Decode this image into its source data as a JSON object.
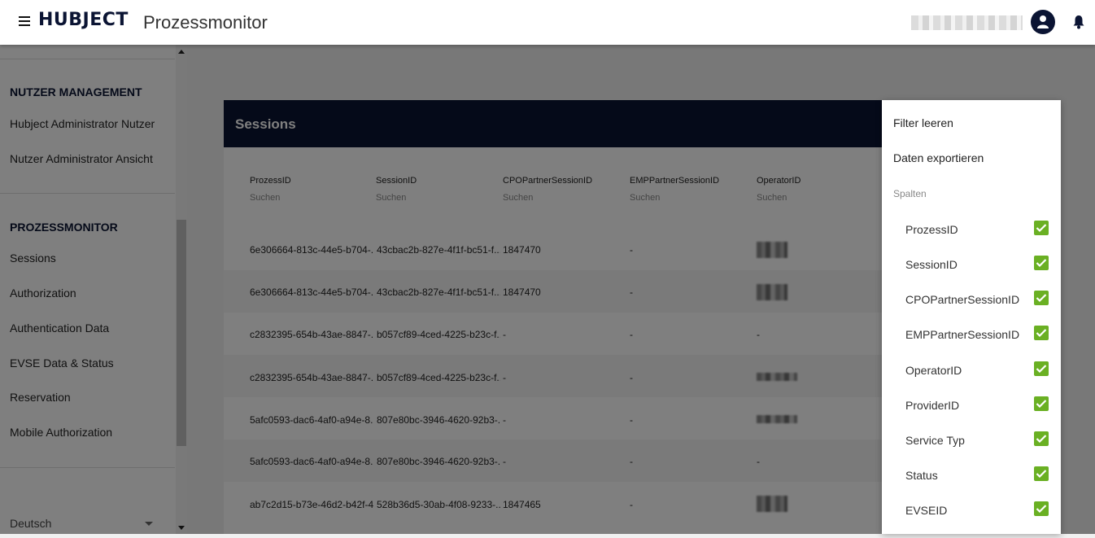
{
  "header": {
    "brand": "HUBJECT",
    "app_title": "Prozessmonitor",
    "menu_icon": "hamburger-menu-icon",
    "avatar_icon": "user-avatar-icon",
    "notification_icon": "bell-icon"
  },
  "sidebar": {
    "sections": [
      {
        "title": "NUTZER MANAGEMENT",
        "items": [
          "Hubject Administrator Nutzer",
          "Nutzer Administrator Ansicht"
        ]
      },
      {
        "title": "PROZESSMONITOR",
        "items": [
          "Sessions",
          "Authorization",
          "Authentication Data",
          "EVSE Data & Status",
          "Reservation",
          "Mobile Authorization"
        ]
      }
    ],
    "language": "Deutsch"
  },
  "card": {
    "title": "Sessions",
    "columns": [
      {
        "header": "ProzessID",
        "search": "Suchen"
      },
      {
        "header": "SessionID",
        "search": "Suchen"
      },
      {
        "header": "CPOPartnerSessionID",
        "search": "Suchen"
      },
      {
        "header": "EMPPartnerSessionID",
        "search": "Suchen"
      },
      {
        "header": "OperatorID",
        "search": "Suchen"
      }
    ],
    "rows": [
      {
        "prozess": "6e306664-813c-44e5-b704-...",
        "session": "43cbac2b-827e-4f1f-bc51-f...",
        "cpo": "1847470",
        "emp": "-",
        "operator": ""
      },
      {
        "prozess": "6e306664-813c-44e5-b704-...",
        "session": "43cbac2b-827e-4f1f-bc51-f...",
        "cpo": "1847470",
        "emp": "-",
        "operator": ""
      },
      {
        "prozess": "c2832395-654b-43ae-8847-...",
        "session": "b057cf89-4ced-4225-b23c-f...",
        "cpo": "-",
        "emp": "-",
        "operator": "-"
      },
      {
        "prozess": "c2832395-654b-43ae-8847-...",
        "session": "b057cf89-4ced-4225-b23c-f...",
        "cpo": "-",
        "emp": "-",
        "operator": ""
      },
      {
        "prozess": "5afc0593-dac6-4af0-a94e-8...",
        "session": "807e80bc-3946-4620-92b3-...",
        "cpo": "-",
        "emp": "-",
        "operator": ""
      },
      {
        "prozess": "5afc0593-dac6-4af0-a94e-8...",
        "session": "807e80bc-3946-4620-92b3-...",
        "cpo": "-",
        "emp": "-",
        "operator": "-"
      },
      {
        "prozess": "ab7c2d15-b73e-46d2-b42f-4...",
        "session": "528b36d5-30ab-4f08-9233-...",
        "cpo": "1847465",
        "emp": "-",
        "operator": ""
      }
    ]
  },
  "menu": {
    "clear_filter": "Filter leeren",
    "export": "Daten exportieren",
    "columns_label": "Spalten",
    "options": [
      {
        "label": "ProzessID",
        "checked": true
      },
      {
        "label": "SessionID",
        "checked": true
      },
      {
        "label": "CPOPartnerSessionID",
        "checked": true
      },
      {
        "label": "EMPPartnerSessionID",
        "checked": true
      },
      {
        "label": "OperatorID",
        "checked": true
      },
      {
        "label": "ProviderID",
        "checked": true
      },
      {
        "label": "Service Typ",
        "checked": true
      },
      {
        "label": "Status",
        "checked": true
      },
      {
        "label": "EVSEID",
        "checked": true
      }
    ]
  },
  "colors": {
    "brand_navy": "#0b1433",
    "check_green": "#6ab023"
  }
}
